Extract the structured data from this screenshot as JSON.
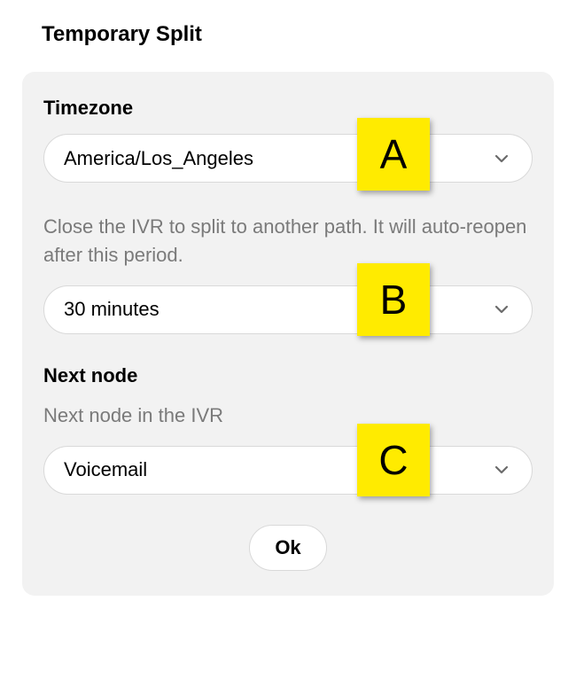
{
  "title": "Temporary Split",
  "panel": {
    "timezone": {
      "label": "Timezone",
      "value": "America/Los_Angeles",
      "marker": "A"
    },
    "duration": {
      "helper": "Close the IVR to split to another path. It will auto-reopen after this period.",
      "value": "30 minutes",
      "marker": "B"
    },
    "next_node": {
      "label": "Next node",
      "helper": "Next node in the IVR",
      "value": "Voicemail",
      "marker": "C"
    },
    "ok_label": "Ok"
  }
}
